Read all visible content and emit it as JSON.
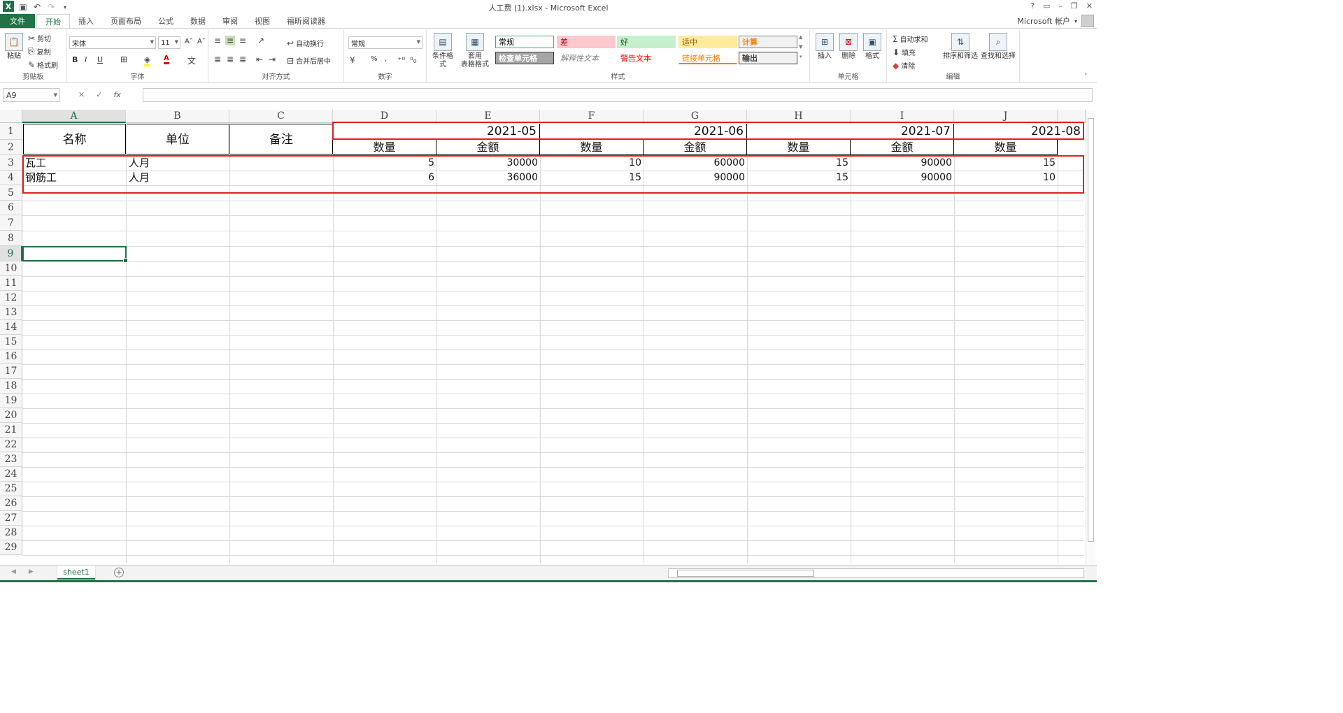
{
  "window": {
    "title": "人工费 (1).xlsx - Microsoft Excel",
    "account": "Microsoft 帐户",
    "controls": [
      "?",
      "▭",
      "–",
      "❐",
      "✕"
    ]
  },
  "tabs": [
    "文件",
    "开始",
    "插入",
    "页面布局",
    "公式",
    "数据",
    "审阅",
    "视图",
    "福昕阅读器"
  ],
  "ribbon": {
    "clipboard": {
      "paste": "粘贴",
      "cut": "剪切",
      "copy": "复制",
      "painter": "格式刷",
      "label": "剪贴板"
    },
    "font": {
      "name": "宋体",
      "size": "11",
      "bold": "B",
      "italic": "I",
      "underline": "U",
      "grow": "A˄",
      "shrink": "A˅",
      "fontcolor": "A",
      "label": "字体"
    },
    "align": {
      "wrap": "自动换行",
      "merge": "合并后居中",
      "label": "对齐方式"
    },
    "number": {
      "format": "常规",
      "percent": "%",
      "comma": ",",
      "label": "数字"
    },
    "styles": {
      "cond": "条件格式",
      "table1": "套用",
      "table2": "表格格式",
      "cells": [
        {
          "text": "常规",
          "bg": "#ffffff",
          "fg": "#000000",
          "border": "#52a865"
        },
        {
          "text": "差",
          "bg": "#ffc7ce",
          "fg": "#9c0006",
          "border": "#ffc7ce"
        },
        {
          "text": "好",
          "bg": "#c6efce",
          "fg": "#006100",
          "border": "#c6efce"
        },
        {
          "text": "适中",
          "bg": "#ffeb9c",
          "fg": "#9c5700",
          "border": "#ffeb9c"
        },
        {
          "text": "计算",
          "bg": "#f2f2f2",
          "fg": "#fa7d00",
          "border": "#7f7f7f"
        },
        {
          "text": "检查单元格",
          "bg": "#a5a5a5",
          "fg": "#ffffff",
          "border": "#3f3f3f"
        },
        {
          "text": "解释性文本",
          "bg": "#ffffff",
          "fg": "#7f7f7f",
          "border": "#ffffff"
        },
        {
          "text": "警告文本",
          "bg": "#ffffff",
          "fg": "#ff0000",
          "border": "#ffffff"
        },
        {
          "text": "链接单元格",
          "bg": "#ffffff",
          "fg": "#fa7d00",
          "border": "#ffffff"
        },
        {
          "text": "输出",
          "bg": "#f2f2f2",
          "fg": "#3f3f3f",
          "border": "#3f3f3f"
        }
      ],
      "label": "样式"
    },
    "cellsgrp": {
      "insert": "插入",
      "delete": "删除",
      "format": "格式",
      "label": "单元格"
    },
    "editing": {
      "autosum": "自动求和",
      "fill": "填充",
      "clear": "清除",
      "sort": "排序和筛选",
      "find": "查找和选择",
      "label": "编辑"
    }
  },
  "formula": {
    "namebox": "A9",
    "fx": "fx",
    "cancel": "✕",
    "enter": "✓",
    "value": ""
  },
  "columns": [
    "A",
    "B",
    "C",
    "D",
    "E",
    "F",
    "G",
    "H",
    "I",
    "J"
  ],
  "rows": [
    "1",
    "2",
    "3",
    "4",
    "5",
    "6",
    "7",
    "8",
    "9",
    "10",
    "11",
    "12",
    "13",
    "14",
    "15",
    "16",
    "17",
    "18",
    "19",
    "20",
    "21",
    "22",
    "23",
    "24",
    "25",
    "26",
    "27",
    "28",
    "29"
  ],
  "sheet": {
    "header": {
      "name": "名称",
      "unit": "单位",
      "note": "备注"
    },
    "months": [
      "2021-05",
      "2021-06",
      "2021-07",
      "2021-08"
    ],
    "subheaders": [
      "数量",
      "金额",
      "数量",
      "金额",
      "数量",
      "金额",
      "数量"
    ],
    "data": [
      {
        "name": "瓦工",
        "unit": "人月",
        "values": [
          "5",
          "30000",
          "10",
          "60000",
          "15",
          "90000",
          "15"
        ]
      },
      {
        "name": "钢筋工",
        "unit": "人月",
        "values": [
          "6",
          "36000",
          "15",
          "90000",
          "15",
          "90000",
          "10"
        ]
      }
    ]
  },
  "sheettabs": [
    "sheet1"
  ],
  "colors": {
    "excel_green": "#217346",
    "annotation_red": "#e02020"
  }
}
